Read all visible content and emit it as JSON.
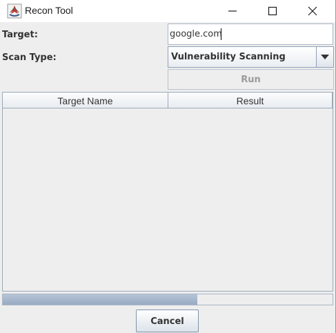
{
  "window": {
    "title": "Recon Tool",
    "icon": "java-cup-icon"
  },
  "form": {
    "target_label": "Target:",
    "target_value": "google.com",
    "scan_type_label": "Scan Type:",
    "scan_type_value": "Vulnerability Scanning",
    "run_label": "Run",
    "run_enabled": false
  },
  "table": {
    "columns": [
      "Target Name",
      "Result"
    ],
    "rows": []
  },
  "progress": {
    "fraction": 0.59
  },
  "footer": {
    "cancel_label": "Cancel"
  },
  "colors": {
    "background": "#eeeeee",
    "progress_fill": "#a3b4c9",
    "disabled_text": "#9a9a9a"
  }
}
